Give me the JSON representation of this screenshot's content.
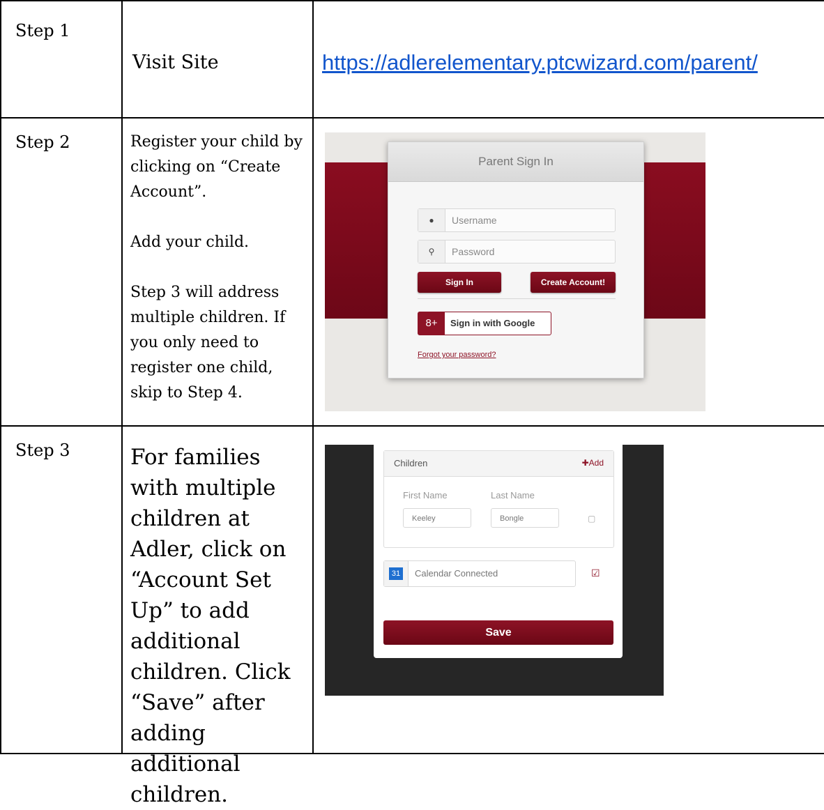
{
  "rows": [
    {
      "step": "Step 1",
      "description": "Visit Site",
      "url": "https://adlerelementary.ptcwizard.com/parent/"
    },
    {
      "step": "Step 2",
      "paragraphs": [
        "Register your child by clicking on “Create Account”.",
        "Add your child.",
        "Step 3 will address multiple children. If you only need to register one child, skip to Step 4."
      ]
    },
    {
      "step": "Step 3",
      "description": "For families with multiple children at Adler, click on “Account Set Up” to add additional children.  Click “Save” after adding additional children."
    }
  ],
  "signin": {
    "title": "Parent Sign In",
    "username_placeholder": "Username",
    "password_placeholder": "Password",
    "sign_in_label": "Sign In",
    "create_account_label": "Create Account!",
    "google_icon_text": "8+",
    "google_label": "Sign in with Google",
    "forgot_label": "Forgot your password?"
  },
  "children": {
    "title": "Children",
    "add_label": "Add",
    "first_name_label": "First Name",
    "last_name_label": "Last Name",
    "first_name_value": "Keeley",
    "last_name_value": "Bongle",
    "calendar_day": "31",
    "calendar_label": "Calendar Connected",
    "save_label": "Save"
  },
  "colors": {
    "brand": "#8d1326",
    "link": "#1155cc"
  },
  "icons": [
    "user-icon",
    "key-icon",
    "google-plus-icon",
    "plus-icon",
    "trash-icon",
    "calendar-icon",
    "checkbox-icon"
  ]
}
